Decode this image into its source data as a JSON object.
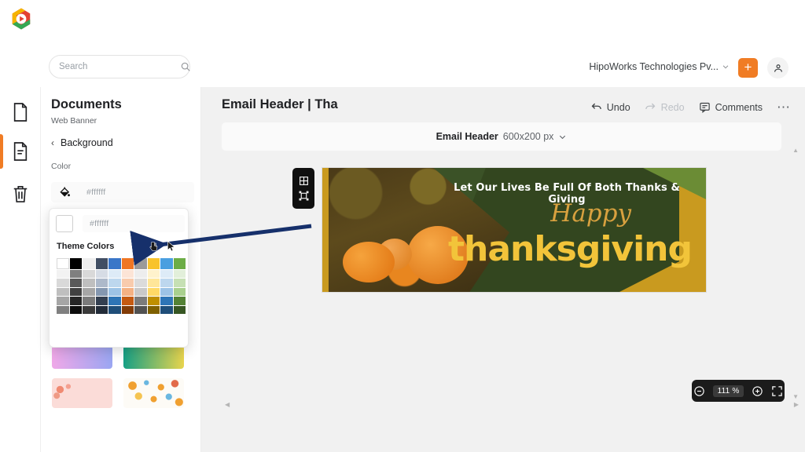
{
  "app": {
    "logo_name": "app-logo"
  },
  "topbar": {
    "search_placeholder": "Search",
    "search_value": "",
    "org_name": "HipoWorks Technologies Pv...",
    "add_label": "+",
    "avatar_name": "user-avatar"
  },
  "rail": {
    "items": [
      {
        "name": "document-icon",
        "label": "Documents"
      },
      {
        "name": "page-icon",
        "label": "Pages"
      },
      {
        "name": "trash-icon",
        "label": "Trash"
      }
    ]
  },
  "panel": {
    "title": "Documents",
    "subtitle": "Web Banner",
    "back_label": "Background",
    "color_label": "Color",
    "color_value": "#ffffff"
  },
  "popover": {
    "hex_value": "#ffffff",
    "swatch_color": "#ffffff",
    "heading": "Theme Colors",
    "head_row": [
      "#ffffff",
      "#000000",
      "#eeeeee",
      "#414e63",
      "#3a76c8",
      "#ef7624",
      "#9a9a9a",
      "#f8c32c",
      "#4a9fe0",
      "#6cad46"
    ],
    "tint_rows": [
      [
        "#f2f2f2",
        "#7f7f7f",
        "#d9d9d9",
        "#d6dce5",
        "#ddebf7",
        "#fce4d6",
        "#ededed",
        "#fff2cc",
        "#ddebf7",
        "#e2efda"
      ],
      [
        "#d9d9d9",
        "#595959",
        "#bfbfbf",
        "#adb9ca",
        "#bdd7ee",
        "#f8cbad",
        "#dbdbdb",
        "#ffe699",
        "#bdd7ee",
        "#c6e0b4"
      ],
      [
        "#bfbfbf",
        "#404040",
        "#a6a6a6",
        "#8497b0",
        "#9dc3e6",
        "#f4b183",
        "#c9c9c9",
        "#ffd966",
        "#9dc3e6",
        "#a9d08e"
      ],
      [
        "#a6a6a6",
        "#262626",
        "#7b7b7b",
        "#333f50",
        "#2e75b6",
        "#c55a11",
        "#7b7b7b",
        "#bf8f00",
        "#2e75b6",
        "#548235"
      ],
      [
        "#808080",
        "#0d0d0d",
        "#3a3a3a",
        "#222b38",
        "#1f4e79",
        "#833c07",
        "#525252",
        "#7f6000",
        "#1f4e79",
        "#375623"
      ]
    ],
    "gradients": [
      {
        "name": "gradient-pink-purple",
        "css": "linear-gradient(90deg,#f0a8e8,#9aa6f2)"
      },
      {
        "name": "gradient-green-yellow",
        "css": "linear-gradient(90deg,#16a085,#e8d44d)"
      }
    ],
    "thumbnails": [
      {
        "name": "thumbnail-pink-texture"
      },
      {
        "name": "thumbnail-confetti-pattern"
      }
    ]
  },
  "canvas": {
    "doc_title": "Email Header | Tha",
    "tools": [
      {
        "name": "undo",
        "label": "Undo",
        "disabled": false
      },
      {
        "name": "redo",
        "label": "Redo",
        "disabled": true
      },
      {
        "name": "comments",
        "label": "Comments",
        "disabled": false
      }
    ],
    "more_label": "⋯",
    "size_name": "Email Header",
    "size_dims": "600x200 px",
    "zoom_level": "111 %"
  },
  "banner": {
    "line1": "Let Our Lives Be Full Of Both Thanks & Giving",
    "happy": "Happy",
    "thanksgiving": "thanksgiving",
    "colors": {
      "green": "#3b5227",
      "gold": "#c99a1f",
      "yellow_text": "#f2c43a",
      "happy_text": "#d8a13f"
    }
  },
  "annotation": {
    "arrow_color": "#16306b",
    "name": "annotation-arrow"
  }
}
